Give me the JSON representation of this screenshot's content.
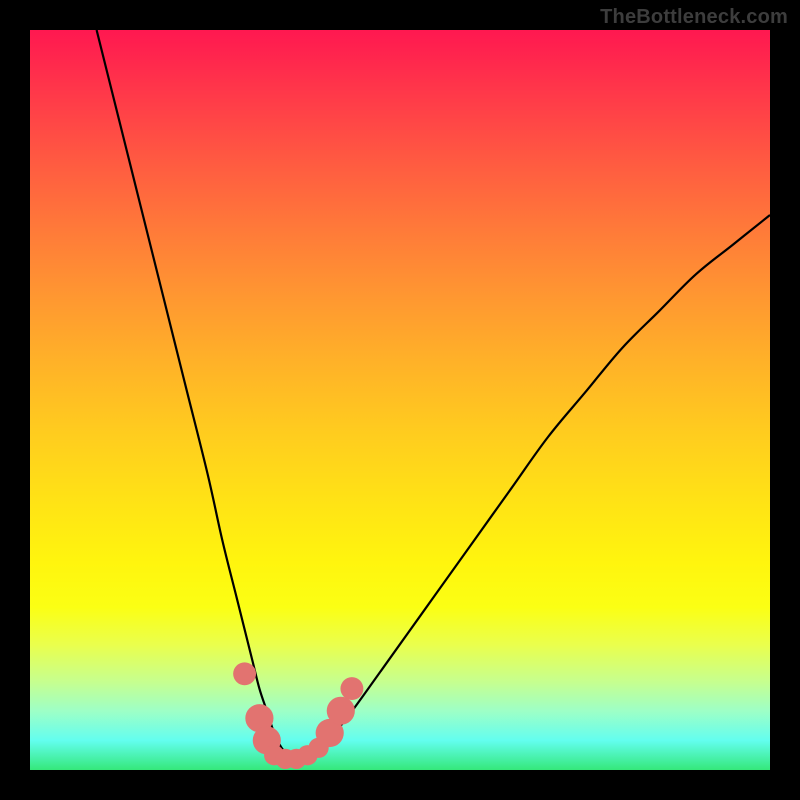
{
  "watermark": "TheBottleneck.com",
  "chart_data": {
    "type": "line",
    "title": "",
    "xlabel": "",
    "ylabel": "",
    "xlim": [
      0,
      100
    ],
    "ylim": [
      0,
      100
    ],
    "grid": false,
    "legend": false,
    "series": [
      {
        "name": "curve",
        "x": [
          9,
          12,
          15,
          18,
          21,
          24,
          26,
          28,
          30,
          31,
          32,
          33,
          34,
          35,
          36,
          37,
          38,
          40,
          42,
          45,
          50,
          55,
          60,
          65,
          70,
          75,
          80,
          85,
          90,
          95,
          100
        ],
        "values": [
          100,
          88,
          76,
          64,
          52,
          40,
          31,
          23,
          15,
          11,
          8,
          5,
          3,
          2,
          2,
          2,
          3,
          4,
          6,
          10,
          17,
          24,
          31,
          38,
          45,
          51,
          57,
          62,
          67,
          71,
          75
        ]
      }
    ],
    "markers": [
      {
        "x": 29,
        "y": 13,
        "size": 1.3
      },
      {
        "x": 31,
        "y": 7,
        "size": 1.6
      },
      {
        "x": 32,
        "y": 4,
        "size": 1.6
      },
      {
        "x": 33,
        "y": 2,
        "size": 1.15
      },
      {
        "x": 34.5,
        "y": 1.5,
        "size": 1.15
      },
      {
        "x": 36,
        "y": 1.5,
        "size": 1.15
      },
      {
        "x": 37.5,
        "y": 2,
        "size": 1.15
      },
      {
        "x": 39,
        "y": 3,
        "size": 1.15
      },
      {
        "x": 40.5,
        "y": 5,
        "size": 1.6
      },
      {
        "x": 42,
        "y": 8,
        "size": 1.6
      },
      {
        "x": 43.5,
        "y": 11,
        "size": 1.3
      }
    ],
    "marker_color": "#e27370",
    "curve_color": "#000000",
    "background": "rainbow-gradient-red-to-green"
  }
}
